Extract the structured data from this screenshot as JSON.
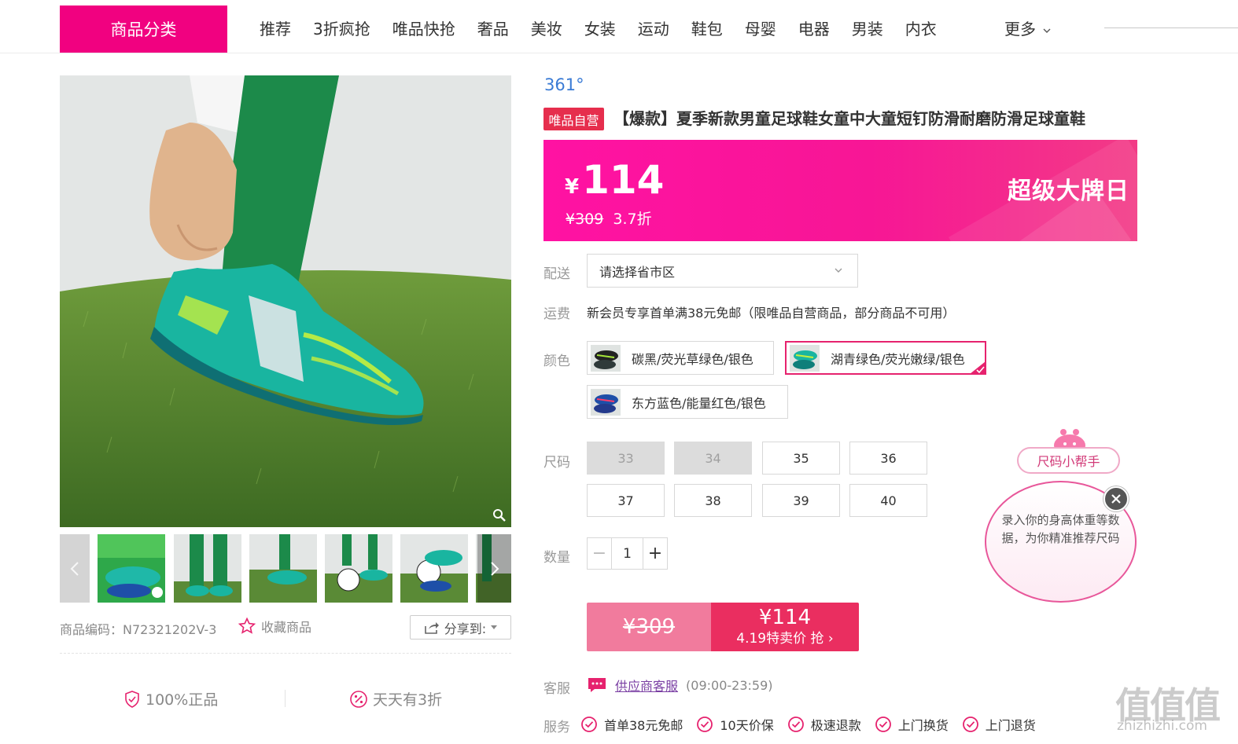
{
  "nav": {
    "category_label": "商品分类",
    "items": [
      "推荐",
      "3折疯抢",
      "唯品快抢",
      "奢品",
      "美妆",
      "女装",
      "运动",
      "鞋包",
      "母婴",
      "电器",
      "男装",
      "内衣"
    ],
    "more_label": "更多"
  },
  "gallery": {
    "product_code": "商品编码：N72321202V-3",
    "favorite_label": "收藏商品",
    "share_label": "分享到:"
  },
  "guarantees": {
    "authentic": "100%正品",
    "daily_sale": "天天有3折"
  },
  "product": {
    "brand": "361°",
    "self_tag": "唯品自营",
    "title": "【爆款】夏季新款男童足球鞋女童中大童短钉防滑耐磨防滑足球童鞋"
  },
  "price": {
    "currency": "¥",
    "current": "114",
    "original": "¥309",
    "discount": "3.7折",
    "event_label": "超级大牌日",
    "accent": "#f10180"
  },
  "delivery": {
    "label": "配送",
    "placeholder": "请选择省市区"
  },
  "shipping": {
    "label": "运费",
    "text": "新会员专享首单满38元免邮（限唯品自营商品，部分商品不可用）"
  },
  "colors": {
    "label": "颜色",
    "options": [
      {
        "name": "碳黑/荧光草绿色/银色",
        "selected": false
      },
      {
        "name": "湖青绿色/荧光嫩绿/银色",
        "selected": true
      },
      {
        "name": "东方蓝色/能量红色/银色",
        "selected": false
      }
    ]
  },
  "sizes": {
    "label": "尺码",
    "options": [
      {
        "size": "33",
        "available": false
      },
      {
        "size": "34",
        "available": false
      },
      {
        "size": "35",
        "available": true
      },
      {
        "size": "36",
        "available": true
      },
      {
        "size": "37",
        "available": true
      },
      {
        "size": "38",
        "available": true
      },
      {
        "size": "39",
        "available": true
      },
      {
        "size": "40",
        "available": true
      }
    ]
  },
  "quantity": {
    "label": "数量",
    "minus": "−",
    "value": "1",
    "plus": "+"
  },
  "buy": {
    "original_price": "¥309",
    "sale_price": "¥114",
    "sale_text": "4.19特卖价 抢 ›"
  },
  "customer_service": {
    "label": "客服",
    "link": "供应商客服",
    "hours": "(09:00-23:59)"
  },
  "services": {
    "label": "服务",
    "items": [
      "首单38元免邮",
      "10天价保",
      "极速退款",
      "上门换货",
      "上门退货"
    ]
  },
  "size_helper": {
    "title": "尺码小帮手",
    "text": "录入你的身高体重等数据，为你精准推荐尺码"
  },
  "watermark": {
    "logo": "值值值",
    "url": "zhizhizhi.com"
  }
}
